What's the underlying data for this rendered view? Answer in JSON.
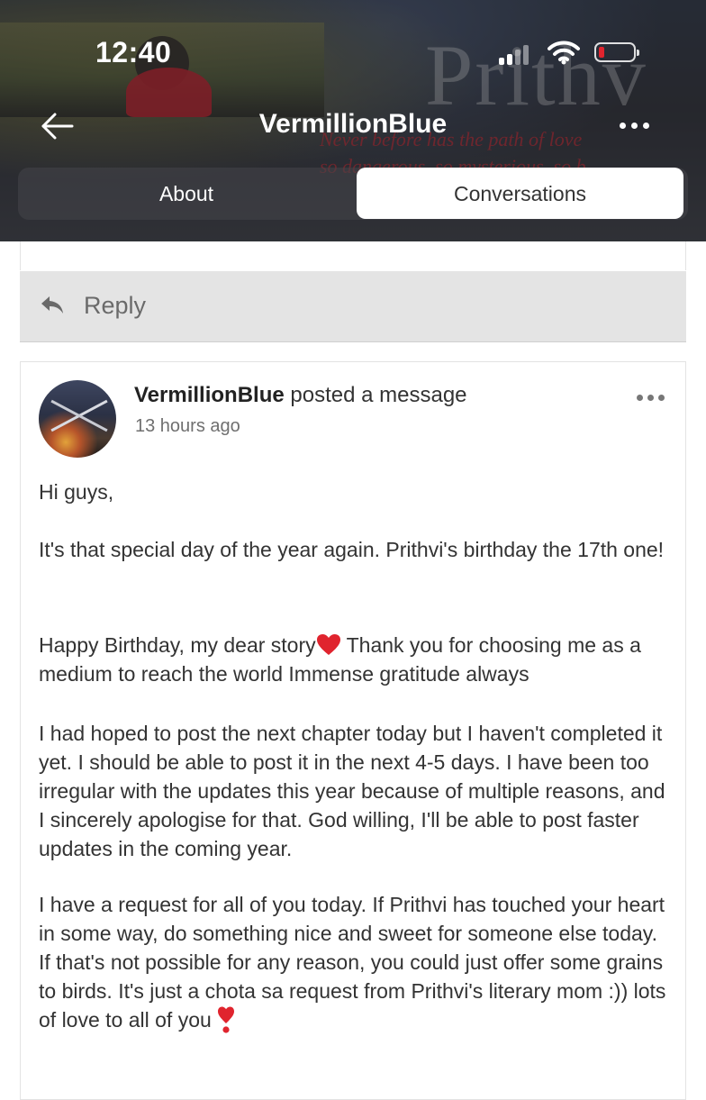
{
  "status_bar": {
    "time": "12:40"
  },
  "header": {
    "title": "VermillionBlue",
    "cover_watermark": "Prithv",
    "cover_tagline_1": "Never before has the path of love",
    "cover_tagline_2": "so dangerous, so mysterious, so b",
    "tabs": [
      {
        "label": "About",
        "selected": false
      },
      {
        "label": "Conversations",
        "selected": true
      }
    ]
  },
  "reply": {
    "label": "Reply"
  },
  "post": {
    "author": "VermillionBlue",
    "action": " posted a message",
    "time_ago": "13 hours ago",
    "greeting": "Hi guys,",
    "para1": "It's that special day of the year again. Prithvi's birthday  the 17th one!",
    "para2a": "Happy Birthday, my dear story",
    "para2b": " Thank you for choosing me as a medium to reach the world  Immense gratitude always",
    "para3": " I had hoped to post the next chapter today but I haven't completed it yet. I should be able to post it in the next 4-5 days. I have been too irregular with the updates this year because of multiple reasons, and I sincerely apologise for that. God willing, I'll be able to post faster updates in the coming year.",
    "para4": "I have a request for all of you today. If Prithvi has touched your heart in some way, do something nice and sweet for someone else today. If that's not possible for any reason, you could just offer some grains to birds. It's just a chota sa request from Prithvi's literary mom :)) lots of love to all of you"
  },
  "colors": {
    "accent_red": "#e0242e",
    "reply_bg": "#e4e4e4"
  }
}
